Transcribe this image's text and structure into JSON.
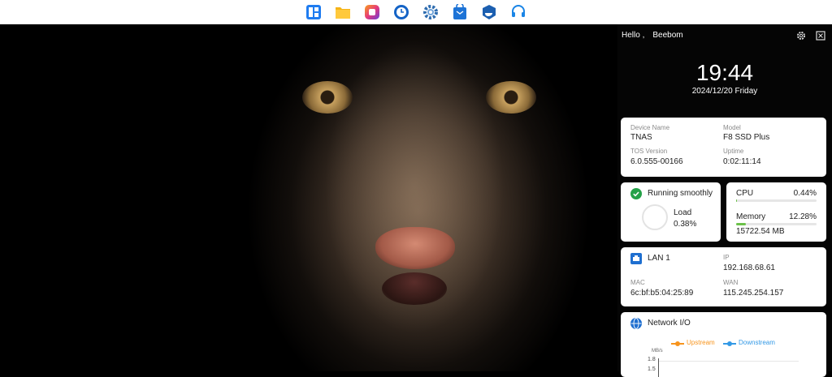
{
  "taskbar": {
    "apps": [
      {
        "icon": "control-panel-icon",
        "color": "#1f7cf0"
      },
      {
        "icon": "folder-icon",
        "color": "#f5b316"
      },
      {
        "icon": "photos-icon",
        "color": "#8e42d8"
      },
      {
        "icon": "clock-icon",
        "color": "#1463c6"
      },
      {
        "icon": "settings-gear-icon",
        "color": "#2f6db0"
      },
      {
        "icon": "app-center-icon",
        "color": "#1d73d6"
      },
      {
        "icon": "docker-icon",
        "color": "#1c5fb0"
      },
      {
        "icon": "support-headset-icon",
        "color": "#1a85e6"
      }
    ]
  },
  "panel": {
    "greeting": "Hello ,",
    "username": "Beebom",
    "time": "19:44",
    "date": "2024/12/20 Friday"
  },
  "device": {
    "name_label": "Device Name",
    "name_value": "TNAS",
    "model_label": "Model",
    "model_value": "F8 SSD Plus",
    "tos_label": "TOS Version",
    "tos_value": "6.0.555-00166",
    "uptime_label": "Uptime",
    "uptime_value": "0:02:11:14"
  },
  "health": {
    "status": "Running smoothly",
    "load_label": "Load",
    "load_value": "0.38%"
  },
  "resources": {
    "cpu_label": "CPU",
    "cpu_value": "0.44%",
    "cpu_fraction": 0.0044,
    "memory_label": "Memory",
    "memory_value": "12.28%",
    "memory_fraction": 0.1228,
    "memory_mb": "15722.54 MB"
  },
  "lan": {
    "name": "LAN 1",
    "ip_label": "IP",
    "ip_value": "192.168.68.61",
    "mac_label": "MAC",
    "mac_value": "6c:bf:b5:04:25:89",
    "wan_label": "WAN",
    "wan_value": "115.245.254.157"
  },
  "network_io": {
    "title": "Network I/O",
    "upstream": "Upstream",
    "downstream": "Downstream",
    "unit": "MB/s",
    "tick_1": "1.8",
    "tick_2": "1.5",
    "upstream_color": "#f7941d",
    "downstream_color": "#3399e6"
  }
}
